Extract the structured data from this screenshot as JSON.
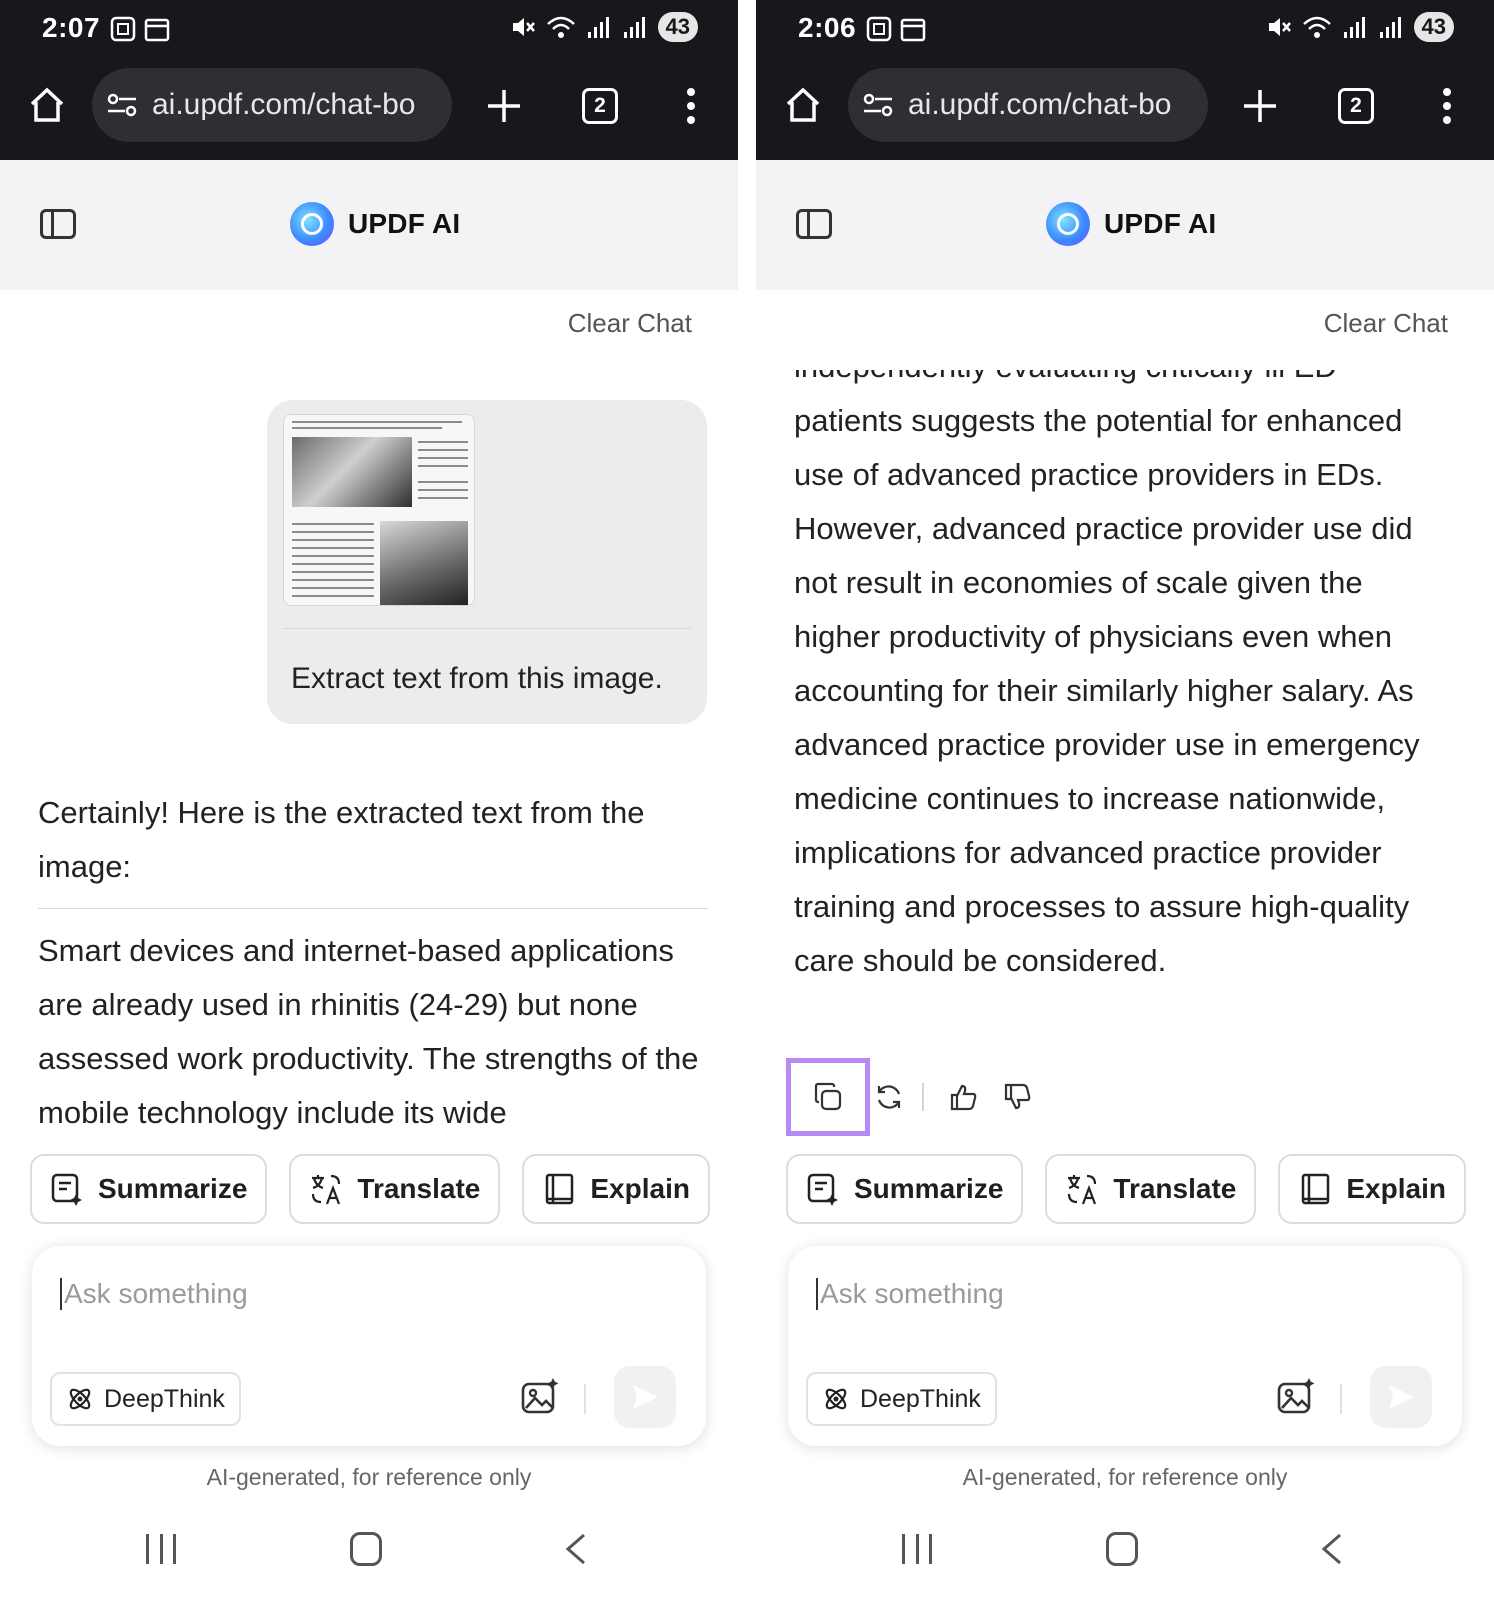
{
  "status": {
    "time_left": "2:07",
    "time_right": "2:06",
    "battery": "43"
  },
  "browser": {
    "url": "ai.updf.com/chat-bo",
    "tab_count": "2"
  },
  "app": {
    "name": "UPDF AI",
    "clear_chat": "Clear Chat"
  },
  "left": {
    "user_prompt": "Extract text from this image.",
    "answer_intro": "Certainly! Here is the extracted text from the image:",
    "answer_body": "Smart devices and internet-based applications are already used in rhinitis (24-29) but none assessed work productivity. The strengths of the mobile technology include its wide"
  },
  "right": {
    "answer_cut_line": "independently evaluating critically ill ED",
    "answer_lines": [
      "independently evaluating critically ill ED",
      "patients suggests the potential for enhanced",
      "use of advanced practice providers in EDs.",
      "However, advanced practice provider use did",
      "not result in economies of scale given the",
      "higher productivity of physicians even when",
      "accounting for their similarly higher salary. As",
      "advanced practice provider use in emergency",
      "medicine continues to increase nationwide,",
      "implications for advanced practice provider",
      "training and processes to assure high-quality",
      "care should be considered."
    ],
    "highlight_color": "#b789f5"
  },
  "quick_actions": {
    "summarize": "Summarize",
    "translate": "Translate",
    "explain": "Explain"
  },
  "composer": {
    "placeholder": "Ask something",
    "deepthink": "DeepThink"
  },
  "disclaimer": "AI-generated, for reference only",
  "icons": [
    "home-icon",
    "site-settings-icon",
    "new-tab-icon",
    "tab-switcher-icon",
    "overflow-menu-icon",
    "sidebar-toggle-icon",
    "copy-icon",
    "regenerate-icon",
    "thumbs-up-icon",
    "thumbs-down-icon",
    "summarize-icon",
    "translate-icon",
    "explain-icon",
    "deepthink-icon",
    "image-upload-icon",
    "send-icon"
  ]
}
